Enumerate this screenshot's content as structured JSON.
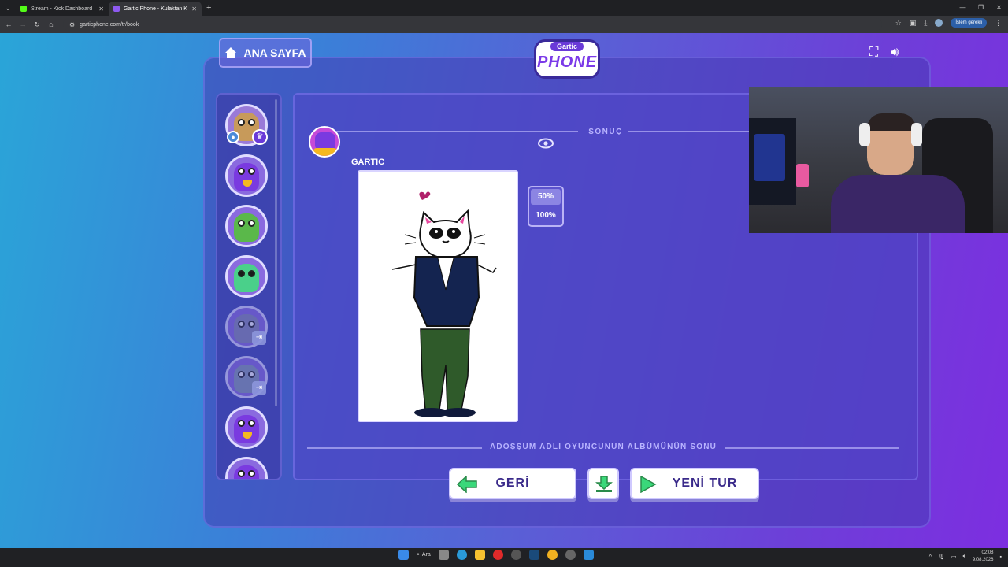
{
  "browser": {
    "tabs": [
      {
        "title": "Stream - Kick Dashboard",
        "favicon_color": "#53fc18",
        "active": false
      },
      {
        "title": "Gartic Phone - Kulaktan Kulağa",
        "favicon_color": "#8e5af0",
        "active": true
      }
    ],
    "url": "garticphone.com/tr/book",
    "action_label": "İşlem gerekli"
  },
  "game": {
    "home_button": "ANA SAYFA",
    "logo_small": "Gartic",
    "logo_big": "PHONE",
    "section_title": "SONUÇ",
    "author_name": "GARTIC",
    "zoom_options": [
      "50%",
      "100%"
    ],
    "zoom_selected": "50%",
    "footer_text": "ADOŞŞUM ADLI OYUNCUNUN ALBÜMÜNÜN SONU",
    "buttons": {
      "back": "GERİ",
      "new_round": "YENİ TUR"
    },
    "icons": {
      "home": "home-icon",
      "fullscreen": "fullscreen-icon",
      "volume": "volume-icon",
      "eye": "eye-icon",
      "download": "download-icon"
    },
    "accent_color": "#6a3ad8"
  },
  "taskbar": {
    "search_label": "Ara",
    "time": "02:08",
    "date": "9.08.2026"
  }
}
